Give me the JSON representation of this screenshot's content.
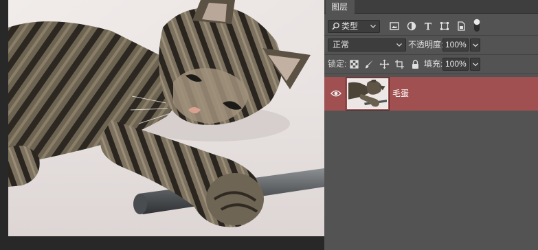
{
  "layers_panel": {
    "tab_label": "图层",
    "filter": {
      "label": "类型",
      "icon": "search-icon"
    },
    "filter_icons": [
      "image-filter-icon",
      "adjustment-filter-icon",
      "type-filter-icon",
      "shape-filter-icon",
      "smart-object-filter-icon"
    ],
    "blend_mode": "正常",
    "opacity_label": "不透明度:",
    "opacity_value": "100%",
    "lock_label": "锁定:",
    "lock_icons": [
      "lock-transparent-icon",
      "lock-image-icon",
      "lock-position-icon",
      "lock-artboard-icon",
      "lock-all-icon"
    ],
    "fill_label": "填充:",
    "fill_value": "100%",
    "layers": [
      {
        "name": "毛蛋",
        "visible": true,
        "selected": true
      }
    ]
  },
  "colors": {
    "panel_bg": "#535353",
    "selected_layer": "#a05050",
    "canvas_bg": "#282828"
  }
}
